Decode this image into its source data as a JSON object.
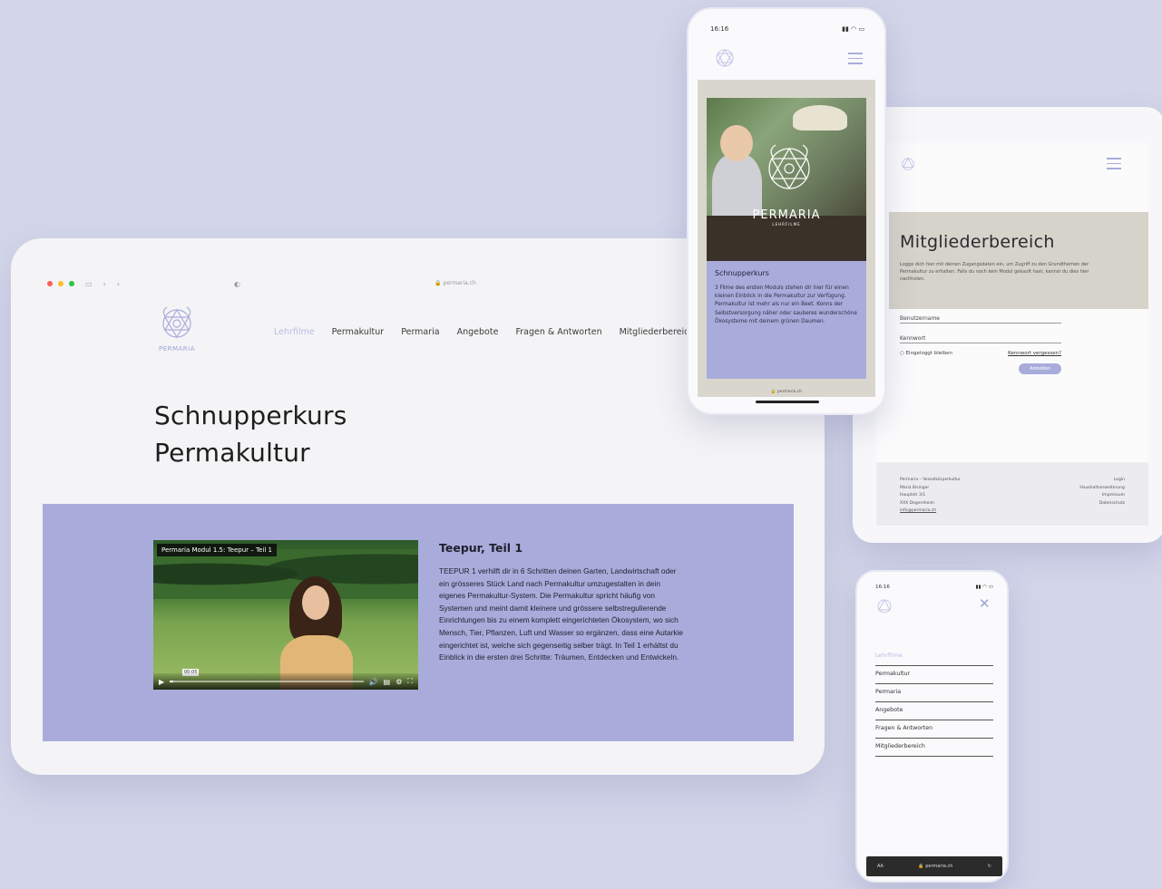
{
  "desktop": {
    "browser": {
      "url": "permaria.ch"
    },
    "logo_text": "PERMARIA",
    "nav": [
      {
        "label": "Lehrfilme",
        "active": true
      },
      {
        "label": "Permakultur",
        "active": false
      },
      {
        "label": "Permaria",
        "active": false
      },
      {
        "label": "Angebote",
        "active": false
      },
      {
        "label": "Fragen & Antworten",
        "active": false
      },
      {
        "label": "Mitgliederbereich",
        "active": false
      }
    ],
    "title_line1": "Schnupperkurs",
    "title_line2": "Permakultur",
    "video": {
      "title": "Permaria Modul 1.5: Teepur – Teil 1",
      "progress": 0.02
    },
    "episode": {
      "title": "Teepur, Teil 1",
      "text": "TEEPUR 1 verhilft dir in 6 Schritten deinen Garten, Landwirtschaft oder ein grösseres Stück Land nach Permakultur umzugestalten in dein eigenes Permakultur-System. Die Permakultur spricht häufig von Systemen und meint damit kleinere und grössere selbstregulierende Einrichtungen bis zu einem komplett eingerichteten Ökosystem, wo sich Mensch, Tier, Pflanzen, Luft und Wasser so ergänzen, dass eine Autarkie eingerichtet ist, welche sich gegenseitig selber trägt. In Teil 1 erhältst du Einblick in die ersten drei Schritte: Träumen, Entdecken und Entwickeln."
    }
  },
  "phone1": {
    "time": "16:16",
    "brand": "PERMARIA",
    "brand_sub": "LEHRFILME",
    "card_title": "Schnupperkurs",
    "card_text": "3 Filme des ersten Moduls stehen dir hier für einen kleinen Einblick in die Permakultur zur Verfügung. Permakultur ist mehr als nur ein Beet. Konns der Selbstversorgung näher oder sauberes wunderschöne Ökosysteme mit deinem grünen Daumen.",
    "url": "permaria.ch"
  },
  "tablet": {
    "heading": "Mitgliederbereich",
    "intro": "Logge dich hier mit deinen Zugangsdaten ein, um Zugriff zu den Grundthemen der Permakultur zu erhalten. Falls du noch kein Modul gekauft hast, kannst du dies hier nachholen.",
    "username_label": "Benutzername",
    "password_label": "Kennwort",
    "remember_label": "Eingeloggt bleiben",
    "forgot_label": "Kennwort vergessen?",
    "submit_label": "Anmelden",
    "footer_left": [
      "Permaria – Vesselkörperkultur",
      "Maria Bisinger",
      "Hauptstr 3/1",
      "XXX Degersheim",
      "info@permaria.ch"
    ],
    "footer_right": [
      "Login",
      "Haushaltserweiterung",
      "Impressum",
      "Datenschutz"
    ]
  },
  "phone2": {
    "time": "16:16",
    "menu": [
      {
        "label": "Lehrfilme",
        "active": true
      },
      {
        "label": "Permakultur",
        "active": false
      },
      {
        "label": "Permaria",
        "active": false
      },
      {
        "label": "Angebote",
        "active": false
      },
      {
        "label": "Fragen & Antworten",
        "active": false
      },
      {
        "label": "Mitgliederbereich",
        "active": false
      }
    ],
    "url": "permaria.ch",
    "aa_label": "AA"
  },
  "colors": {
    "background": "#d3d5ea",
    "accent": "#a9acdb",
    "accent_light": "#b9bce3",
    "sand": "#d6d3ca"
  }
}
